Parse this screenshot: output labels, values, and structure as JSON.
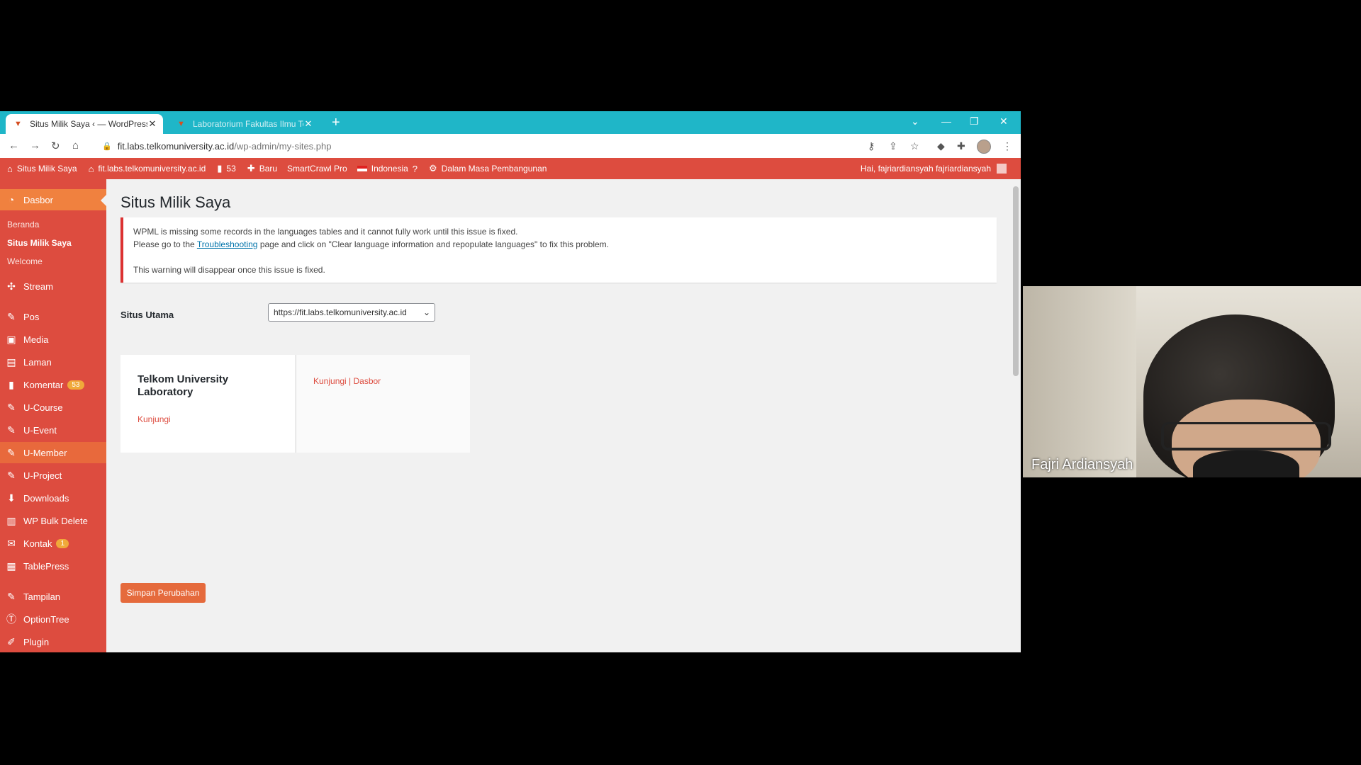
{
  "browser": {
    "tabs": [
      {
        "title": "Situs Milik Saya ‹ — WordPress",
        "active": true
      },
      {
        "title": "Laboratorium Fakultas Ilmu Terap",
        "active": false
      }
    ],
    "url_domain": "fit.labs.telkomuniversity.ac.id",
    "url_path": "/wp-admin/my-sites.php",
    "accent_color": "#1fb6c8"
  },
  "adminbar": {
    "my_sites": "Situs Milik Saya",
    "site": "fit.labs.telkomuniversity.ac.id",
    "comments_count": "53",
    "new": "Baru",
    "smartcrawl": "SmartCrawl Pro",
    "language": "Indonesia",
    "maintenance": "Dalam Masa Pembangunan",
    "greeting": "Hai, fajriardiansyah fajriardiansyah",
    "color": "#dd4c3f"
  },
  "sidebar": {
    "dashboard": "Dasbor",
    "submenu": [
      "Beranda",
      "Situs Milik Saya",
      "Welcome"
    ],
    "items": [
      {
        "label": "Stream",
        "icon": "stream-icon"
      },
      {
        "label": "Pos",
        "icon": "pin-icon"
      },
      {
        "label": "Media",
        "icon": "media-icon"
      },
      {
        "label": "Laman",
        "icon": "page-icon"
      },
      {
        "label": "Komentar",
        "icon": "comment-icon",
        "badge": "53"
      },
      {
        "label": "U-Course",
        "icon": "pin-icon"
      },
      {
        "label": "U-Event",
        "icon": "pin-icon"
      },
      {
        "label": "U-Member",
        "icon": "pin-icon"
      },
      {
        "label": "U-Project",
        "icon": "pin-icon"
      },
      {
        "label": "Downloads",
        "icon": "download-icon"
      },
      {
        "label": "WP Bulk Delete",
        "icon": "trash-icon"
      },
      {
        "label": "Kontak",
        "icon": "mail-icon",
        "badge": "1"
      },
      {
        "label": "TablePress",
        "icon": "table-icon"
      },
      {
        "label": "Tampilan",
        "icon": "brush-icon"
      },
      {
        "label": "OptionTree",
        "icon": "optiontree-icon"
      },
      {
        "label": "Plugin",
        "icon": "plugin-icon"
      }
    ]
  },
  "main": {
    "title": "Situs Milik Saya",
    "notice": {
      "line1": "WPML is missing some records in the languages tables and it cannot fully work until this issue is fixed.",
      "line2_pre": "Please go to the ",
      "line2_link": "Troubleshooting",
      "line2_post": " page and click on \"Clear language information and repopulate languages\" to fix this problem.",
      "line3": "This warning will disappear once this issue is fixed."
    },
    "primary_site_label": "Situs Utama",
    "primary_site_value": "https://fit.labs.telkomuniversity.ac.id",
    "sites": [
      {
        "name": "Telkom University Laboratory",
        "link": "Kunjungi"
      },
      {
        "links": "Kunjungi | Dasbor"
      }
    ],
    "save_button": "Simpan Perubahan"
  },
  "webcam": {
    "participant": "Fajri Ardiansyah"
  }
}
